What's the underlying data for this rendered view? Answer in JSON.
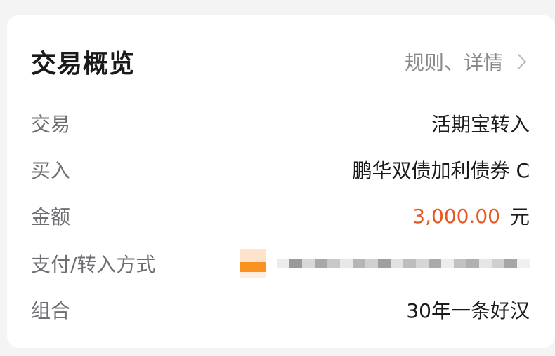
{
  "card": {
    "title": "交易概览",
    "rules_link": "规则、详情"
  },
  "rows": [
    {
      "label": "交易",
      "value": "活期宝转入"
    },
    {
      "label": "买入",
      "value": "鹏华双债加利债券 C"
    },
    {
      "label": "金额",
      "amount": "3,000.00",
      "unit": "元"
    },
    {
      "label": "支付/转入方式",
      "value": ""
    },
    {
      "label": "组合",
      "value": "30年一条好汉"
    }
  ],
  "colors": {
    "accent_amount": "#e8571f",
    "payment_icon": "#f7931e"
  },
  "icons": {
    "rules_link": "chevron-right-icon",
    "payment_method": "bank-logo-icon"
  }
}
